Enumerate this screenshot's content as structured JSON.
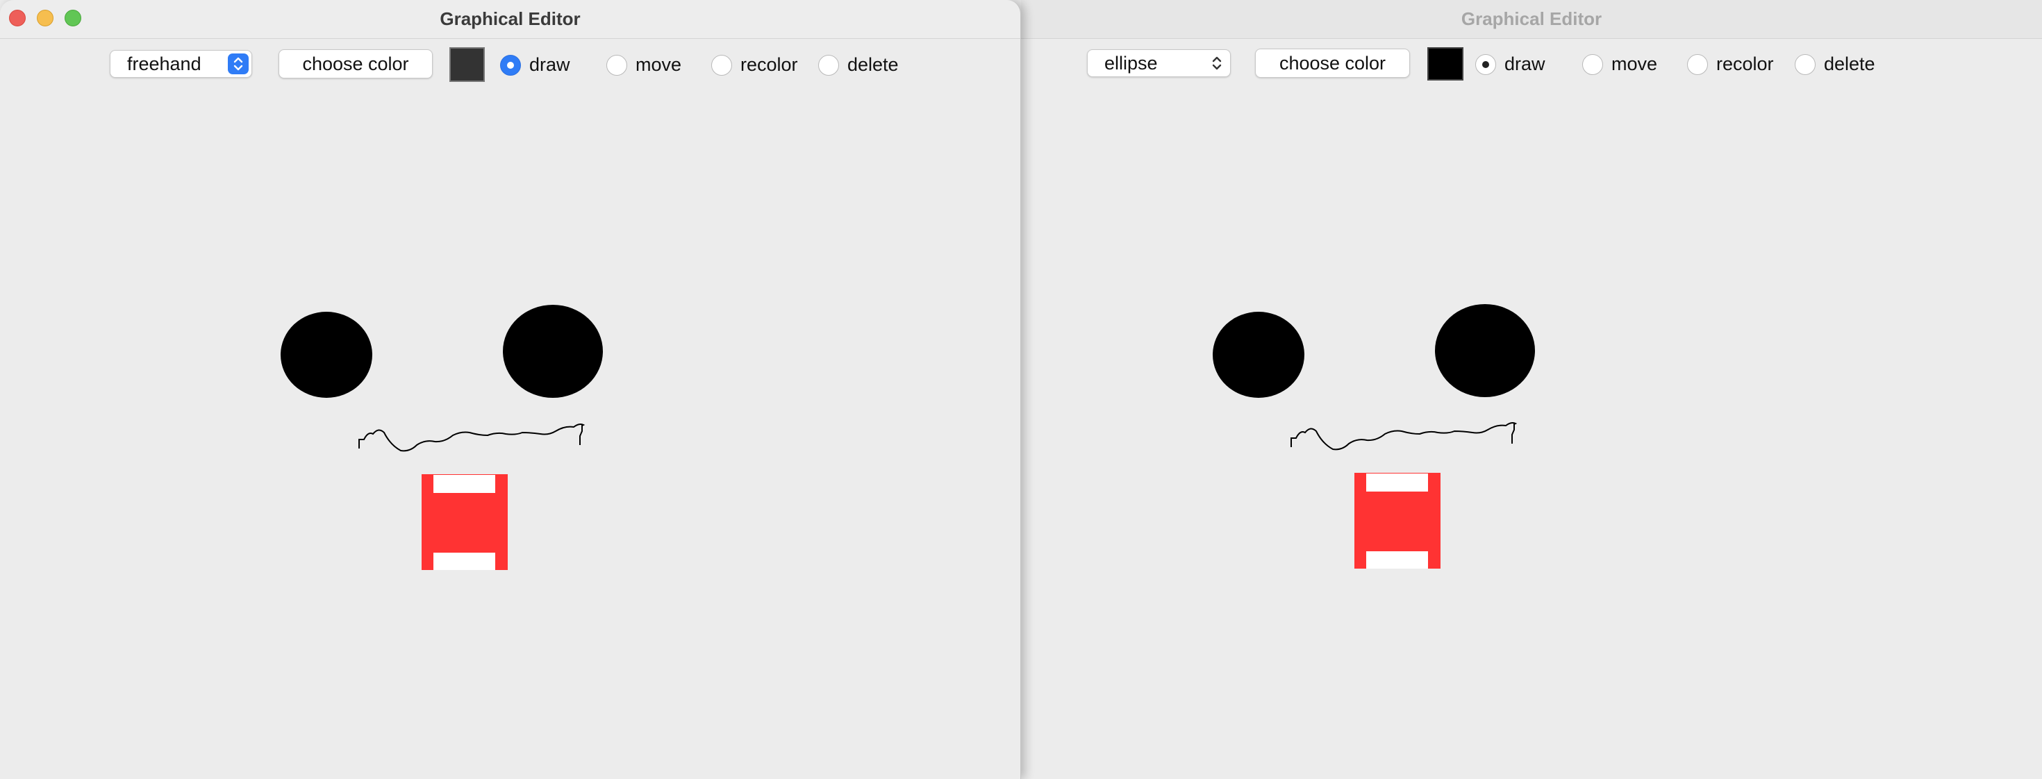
{
  "left_window": {
    "title": "Graphical Editor",
    "shape_select": "freehand",
    "choose_color_label": "choose color",
    "swatch_color": "#333333",
    "modes": [
      "draw",
      "move",
      "recolor",
      "delete"
    ],
    "selected_mode": "draw"
  },
  "right_window": {
    "title": "Graphical Editor",
    "shape_select": "ellipse",
    "choose_color_label": "choose color",
    "swatch_color": "#000000",
    "modes": [
      "draw",
      "move",
      "recolor",
      "delete"
    ],
    "selected_mode": "draw"
  },
  "colors": {
    "eye": "#000000",
    "mouth_red": "#ff3333",
    "mouth_white": "#ffffff",
    "stroke": "#000000"
  }
}
